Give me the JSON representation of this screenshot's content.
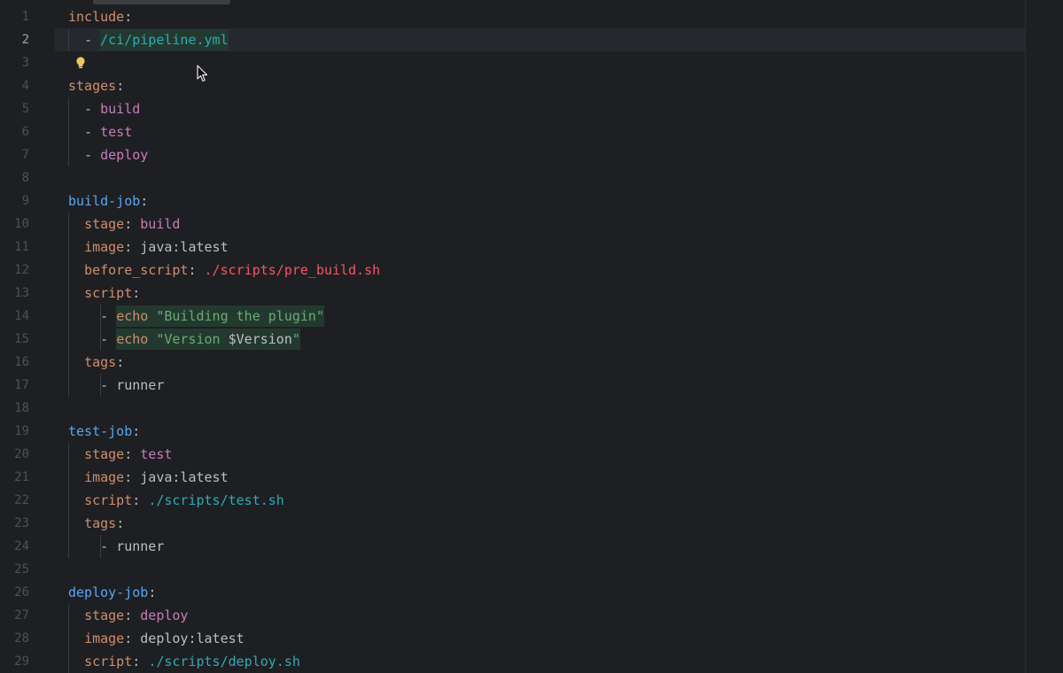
{
  "editor": {
    "current_line": 2,
    "lines": [
      {
        "num": "1",
        "tokens": [
          {
            "t": "include",
            "c": "k-key"
          },
          {
            "t": ":",
            "c": "punct"
          }
        ]
      },
      {
        "num": "2",
        "tokens": [
          {
            "t": "  - ",
            "c": "punct"
          },
          {
            "t": "/ci/pipeline.yml",
            "c": "k-path",
            "hl": true
          }
        ]
      },
      {
        "num": "3",
        "tokens": []
      },
      {
        "num": "4",
        "tokens": [
          {
            "t": "stages",
            "c": "k-key"
          },
          {
            "t": ":",
            "c": "punct"
          }
        ]
      },
      {
        "num": "5",
        "tokens": [
          {
            "t": "  - ",
            "c": "punct"
          },
          {
            "t": "build",
            "c": "k-stage"
          }
        ]
      },
      {
        "num": "6",
        "tokens": [
          {
            "t": "  - ",
            "c": "punct"
          },
          {
            "t": "test",
            "c": "k-stage"
          }
        ]
      },
      {
        "num": "7",
        "tokens": [
          {
            "t": "  - ",
            "c": "punct"
          },
          {
            "t": "deploy",
            "c": "k-stage"
          }
        ]
      },
      {
        "num": "8",
        "tokens": []
      },
      {
        "num": "9",
        "tokens": [
          {
            "t": "build-job",
            "c": "k-job"
          },
          {
            "t": ":",
            "c": "punct"
          }
        ]
      },
      {
        "num": "10",
        "tokens": [
          {
            "t": "  ",
            "c": "punct"
          },
          {
            "t": "stage",
            "c": "k-key"
          },
          {
            "t": ": ",
            "c": "punct"
          },
          {
            "t": "build",
            "c": "k-stage"
          }
        ]
      },
      {
        "num": "11",
        "tokens": [
          {
            "t": "  ",
            "c": "punct"
          },
          {
            "t": "image",
            "c": "k-key"
          },
          {
            "t": ": ",
            "c": "punct"
          },
          {
            "t": "java:latest",
            "c": "k-plain"
          }
        ]
      },
      {
        "num": "12",
        "tokens": [
          {
            "t": "  ",
            "c": "punct"
          },
          {
            "t": "before_script",
            "c": "k-key"
          },
          {
            "t": ": ",
            "c": "punct"
          },
          {
            "t": "./scripts/pre_build.sh",
            "c": "k-red"
          }
        ]
      },
      {
        "num": "13",
        "tokens": [
          {
            "t": "  ",
            "c": "punct"
          },
          {
            "t": "script",
            "c": "k-key"
          },
          {
            "t": ":",
            "c": "punct"
          }
        ]
      },
      {
        "num": "14",
        "tokens": [
          {
            "t": "    - ",
            "c": "punct"
          },
          {
            "t": "echo",
            "c": "k-cmd",
            "hl": true
          },
          {
            "t": " ",
            "c": "punct",
            "hl": true
          },
          {
            "t": "\"Building the plugin\"",
            "c": "k-str",
            "hl": true
          }
        ]
      },
      {
        "num": "15",
        "tokens": [
          {
            "t": "    - ",
            "c": "punct"
          },
          {
            "t": "echo",
            "c": "k-cmd",
            "hl": true
          },
          {
            "t": " ",
            "c": "punct",
            "hl": true
          },
          {
            "t": "\"Version ",
            "c": "k-str",
            "hl": true
          },
          {
            "t": "$Version",
            "c": "k-var",
            "hl": true
          },
          {
            "t": "\"",
            "c": "k-str",
            "hl": true
          }
        ]
      },
      {
        "num": "16",
        "tokens": [
          {
            "t": "  ",
            "c": "punct"
          },
          {
            "t": "tags",
            "c": "k-key"
          },
          {
            "t": ":",
            "c": "punct"
          }
        ]
      },
      {
        "num": "17",
        "tokens": [
          {
            "t": "    - ",
            "c": "punct"
          },
          {
            "t": "runner",
            "c": "k-plain"
          }
        ]
      },
      {
        "num": "18",
        "tokens": []
      },
      {
        "num": "19",
        "tokens": [
          {
            "t": "test-job",
            "c": "k-job"
          },
          {
            "t": ":",
            "c": "punct"
          }
        ]
      },
      {
        "num": "20",
        "tokens": [
          {
            "t": "  ",
            "c": "punct"
          },
          {
            "t": "stage",
            "c": "k-key"
          },
          {
            "t": ": ",
            "c": "punct"
          },
          {
            "t": "test",
            "c": "k-stage"
          }
        ]
      },
      {
        "num": "21",
        "tokens": [
          {
            "t": "  ",
            "c": "punct"
          },
          {
            "t": "image",
            "c": "k-key"
          },
          {
            "t": ": ",
            "c": "punct"
          },
          {
            "t": "java:latest",
            "c": "k-plain"
          }
        ]
      },
      {
        "num": "22",
        "tokens": [
          {
            "t": "  ",
            "c": "punct"
          },
          {
            "t": "script",
            "c": "k-key"
          },
          {
            "t": ": ",
            "c": "punct"
          },
          {
            "t": "./scripts/test.sh",
            "c": "k-path"
          }
        ]
      },
      {
        "num": "23",
        "tokens": [
          {
            "t": "  ",
            "c": "punct"
          },
          {
            "t": "tags",
            "c": "k-key"
          },
          {
            "t": ":",
            "c": "punct"
          }
        ]
      },
      {
        "num": "24",
        "tokens": [
          {
            "t": "    - ",
            "c": "punct"
          },
          {
            "t": "runner",
            "c": "k-plain"
          }
        ]
      },
      {
        "num": "25",
        "tokens": []
      },
      {
        "num": "26",
        "tokens": [
          {
            "t": "deploy-job",
            "c": "k-job"
          },
          {
            "t": ":",
            "c": "punct"
          }
        ]
      },
      {
        "num": "27",
        "tokens": [
          {
            "t": "  ",
            "c": "punct"
          },
          {
            "t": "stage",
            "c": "k-key"
          },
          {
            "t": ": ",
            "c": "punct"
          },
          {
            "t": "deploy",
            "c": "k-stage"
          }
        ]
      },
      {
        "num": "28",
        "tokens": [
          {
            "t": "  ",
            "c": "punct"
          },
          {
            "t": "image",
            "c": "k-key"
          },
          {
            "t": ": ",
            "c": "punct"
          },
          {
            "t": "deploy:latest",
            "c": "k-plain"
          }
        ]
      },
      {
        "num": "29",
        "tokens": [
          {
            "t": "  ",
            "c": "punct"
          },
          {
            "t": "script",
            "c": "k-key"
          },
          {
            "t": ": ",
            "c": "punct"
          },
          {
            "t": "./scripts/deploy.sh",
            "c": "k-path"
          }
        ]
      }
    ]
  },
  "icons": {
    "intention": "lightbulb-icon",
    "pointer": "mouse-pointer-icon"
  },
  "colors": {
    "background": "#1e1f22",
    "yaml_key": "#cf8e6d",
    "job_name": "#56a8f5",
    "stage_value": "#c77dbb",
    "path_value": "#2aacb8",
    "error_value": "#f75464",
    "string_value": "#6aab73",
    "injection_highlight": "#23392f",
    "bulb": "#f2c55c"
  }
}
